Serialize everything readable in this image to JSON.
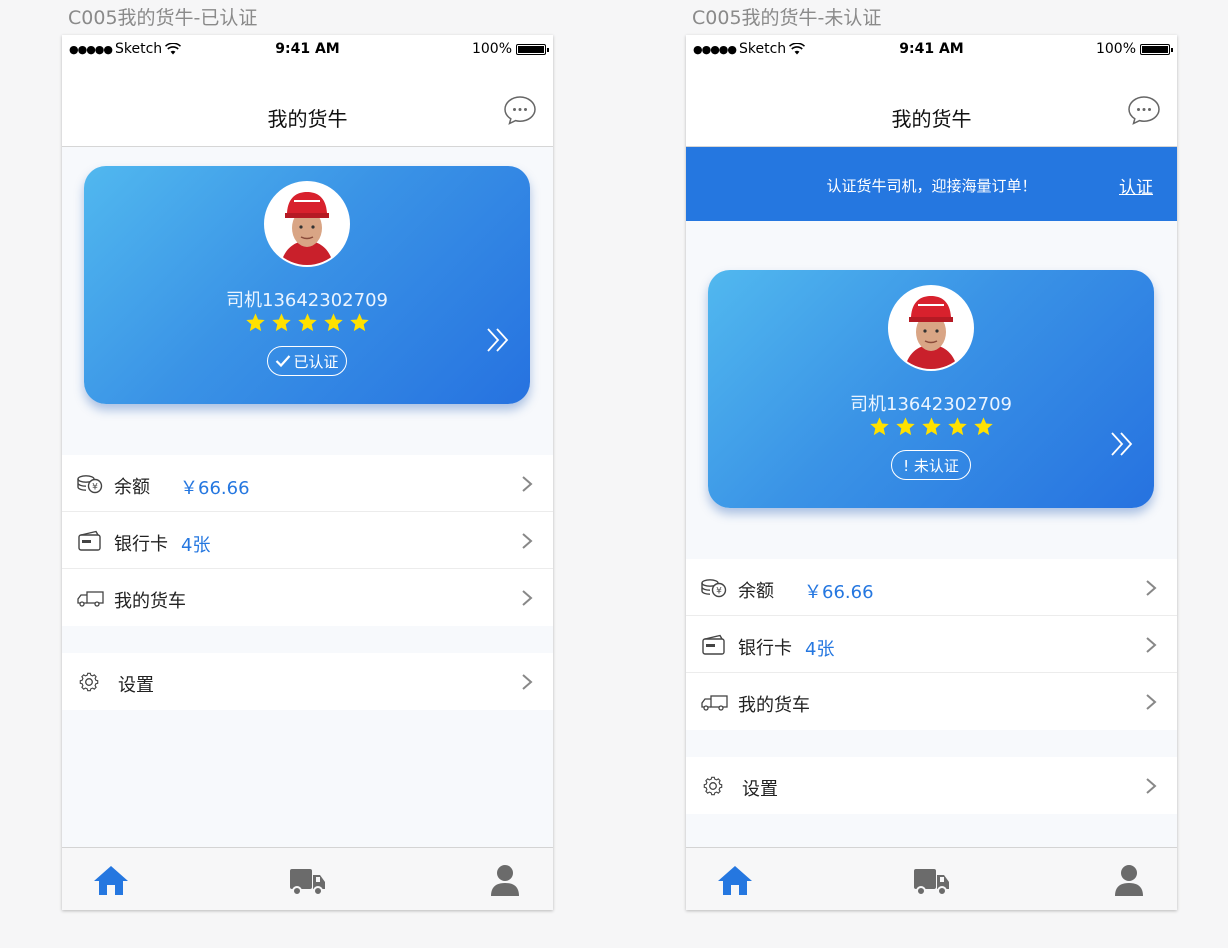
{
  "screens": [
    {
      "artboard_label": "C005我的货牛-已认证",
      "status": {
        "carrier": "Sketch",
        "time": "9:41 AM",
        "battery": "100%"
      },
      "nav": {
        "title": "我的货牛",
        "message_icon": "chat-bubble-icon"
      },
      "card": {
        "driver_name": "司机13642302709",
        "rating": 5,
        "badge_text": "已认证",
        "badge_icon": "check-icon",
        "gradient": [
          "#51b8ef",
          "#2672e0"
        ]
      },
      "menu": {
        "balance_label": "余额",
        "balance_value": "￥66.66",
        "bank_label": "银行卡",
        "bank_value": "4张",
        "truck_label": "我的货车",
        "settings_label": "设置"
      },
      "tabs": [
        "home-icon",
        "truck-icon",
        "person-icon"
      ],
      "active_tab": "home-icon"
    },
    {
      "artboard_label": "C005我的货牛-未认证",
      "status": {
        "carrier": "Sketch",
        "time": "9:41 AM",
        "battery": "100%"
      },
      "nav": {
        "title": "我的货牛",
        "message_icon": "chat-bubble-icon"
      },
      "banner": {
        "text": "认证货牛司机，迎接海量订单！",
        "link": "认证",
        "color": "#2577e0"
      },
      "card": {
        "driver_name": "司机13642302709",
        "rating": 5,
        "badge_text": "! 未认证",
        "gradient": [
          "#51b8ef",
          "#2672e0"
        ]
      },
      "menu": {
        "balance_label": "余额",
        "balance_value": "￥66.66",
        "bank_label": "银行卡",
        "bank_value": "4张",
        "truck_label": "我的货车",
        "settings_label": "设置"
      },
      "tabs": [
        "home-icon",
        "truck-icon",
        "person-icon"
      ],
      "active_tab": "home-icon"
    }
  ],
  "colors": {
    "accent": "#2577e0",
    "star": "#ffe100",
    "inactive_tab": "#6b6b6b"
  }
}
